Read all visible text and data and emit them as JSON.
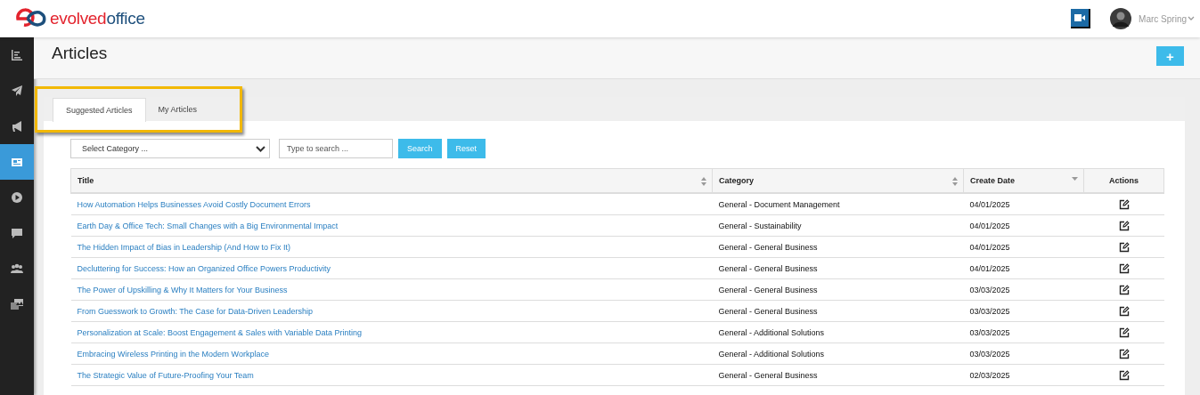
{
  "header": {
    "logo": {
      "part_1": "evolved",
      "part_2": "office"
    },
    "user": {
      "name": "Marc Spring"
    }
  },
  "sidebar": {
    "items": [
      {
        "kind": "chart",
        "selected": false
      },
      {
        "kind": "send",
        "selected": false
      },
      {
        "kind": "megaphone",
        "selected": false
      },
      {
        "kind": "article",
        "selected": true
      },
      {
        "kind": "play",
        "selected": false
      },
      {
        "kind": "chat",
        "selected": false
      },
      {
        "kind": "people",
        "selected": false
      },
      {
        "kind": "gallery",
        "selected": false
      }
    ]
  },
  "page": {
    "title": "Articles",
    "add_button": "+"
  },
  "tabs": [
    {
      "label": "Suggested Articles",
      "selected": true
    },
    {
      "label": "My Articles",
      "selected": false
    }
  ],
  "filters": {
    "category": "Select Category ...",
    "search_placeholder": "Type to search ...",
    "buttons": [
      "Search",
      "Reset"
    ]
  },
  "table": {
    "columns": [
      {
        "label": "Title",
        "sortable": true,
        "sorted_desc": false
      },
      {
        "label": "Category",
        "sortable": true,
        "sorted_desc": false
      },
      {
        "label": "Create Date",
        "sortable": true,
        "sorted_desc": true
      },
      {
        "label": "Actions",
        "sortable": false,
        "sorted_desc": false
      }
    ],
    "rows": [
      {
        "title": "How Automation Helps Businesses Avoid Costly Document Errors",
        "category": "General - Document Management",
        "date": "04/01/2025"
      },
      {
        "title": "Earth Day & Office Tech: Small Changes with a Big Environmental Impact",
        "category": "General - Sustainability",
        "date": "04/01/2025"
      },
      {
        "title": "The Hidden Impact of Bias in Leadership (And How to Fix It)",
        "category": "General - General Business",
        "date": "04/01/2025"
      },
      {
        "title": "Decluttering for Success: How an Organized Office Powers Productivity",
        "category": "General - General Business",
        "date": "04/01/2025"
      },
      {
        "title": "The Power of Upskilling & Why It Matters for Your Business",
        "category": "General - General Business",
        "date": "03/03/2025"
      },
      {
        "title": "From Guesswork to Growth: The Case for Data-Driven Leadership",
        "category": "General - General Business",
        "date": "03/03/2025"
      },
      {
        "title": "Personalization at Scale: Boost Engagement & Sales with Variable Data Printing",
        "category": "General - Additional Solutions",
        "date": "03/03/2025"
      },
      {
        "title": "Embracing Wireless Printing in the Modern Workplace",
        "category": "General - Additional Solutions",
        "date": "03/03/2025"
      },
      {
        "title": "The Strategic Value of Future-Proofing Your Team",
        "category": "General - General Business",
        "date": "02/03/2025"
      }
    ]
  }
}
